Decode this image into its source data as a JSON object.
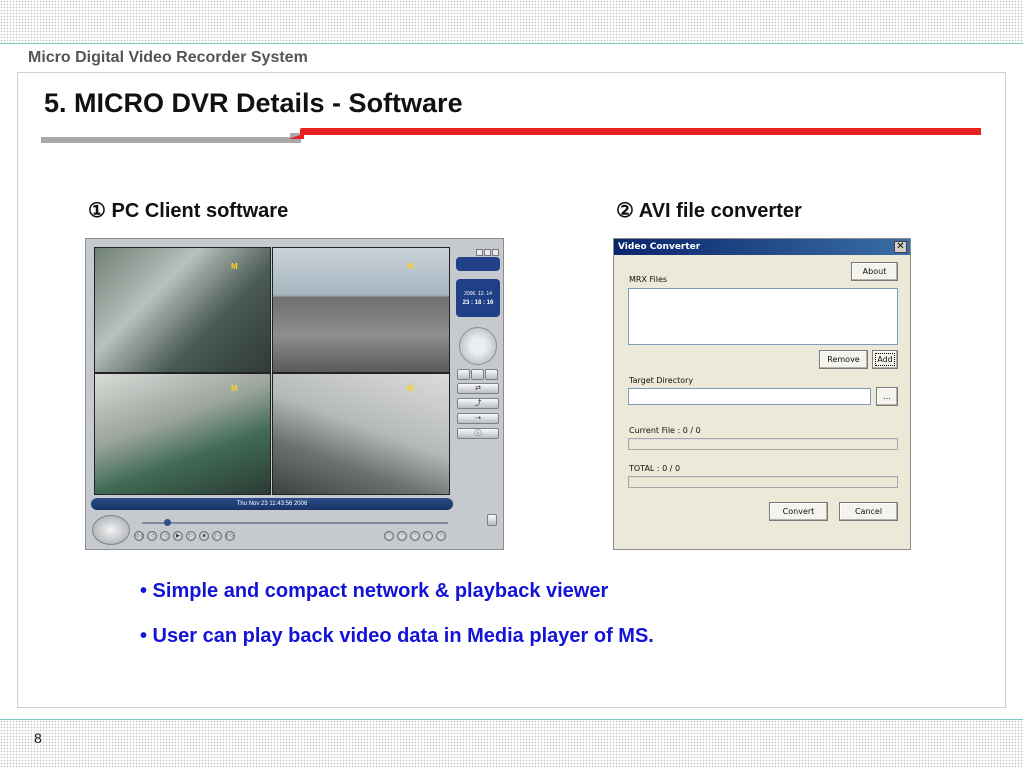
{
  "header": {
    "title": "Micro Digital Video Recorder System"
  },
  "slide": {
    "title": "5. MICRO DVR Details - Software",
    "left_caption": "① PC Client software",
    "right_caption": "② AVI file converter",
    "bullets": [
      "• Simple and compact network & playback viewer",
      "• User can play back video data in Media player of MS."
    ],
    "page_number": "8"
  },
  "pc_client": {
    "camera_mark": "M",
    "date_display": "2006. 12. 14",
    "time_display": "23 : 18 : 16",
    "status_time": "Thu Nov 23 11:43:56 2006",
    "playback_buttons": [
      "◁◁",
      "◁",
      "◁",
      "▶",
      "▷",
      "■",
      "▷",
      "▷▷"
    ],
    "right_buttons": [
      "○",
      "○",
      "○",
      "○",
      "○"
    ],
    "side_icons": [
      "⇄",
      "⤴",
      "⇢",
      "ⓘ"
    ]
  },
  "video_converter": {
    "title": "Video Converter",
    "close_label": "✕",
    "about_label": "About",
    "mrx_files_label": "MRX Files",
    "remove_label": "Remove",
    "add_label": "Add",
    "target_dir_label": "Target Directory",
    "target_dir_value": "",
    "browse_label": "...",
    "current_file_label": "Current File :  0 / 0",
    "total_label": "TOTAL :  0 / 0",
    "convert_label": "Convert",
    "cancel_label": "Cancel"
  },
  "colors": {
    "accent_red": "#e8201f",
    "bullet_blue": "#1313d8",
    "title_bar_blue": "#0a246a"
  }
}
